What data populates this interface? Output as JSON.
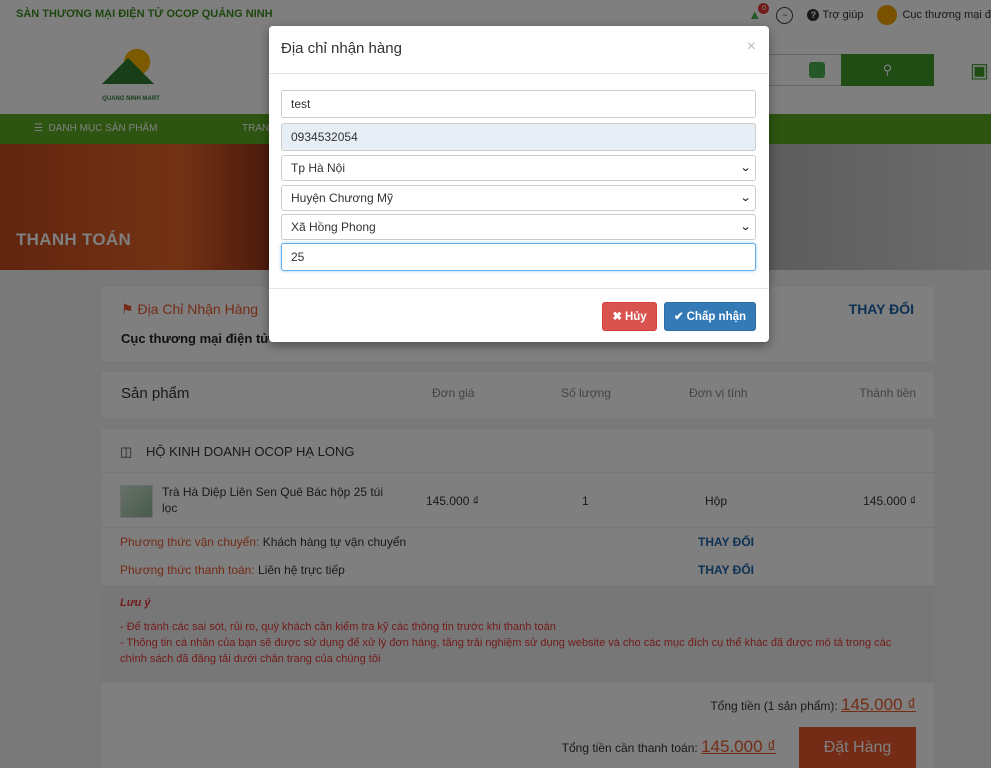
{
  "topbar": {
    "site_name": "SÀN THƯƠNG MẠI ĐIỆN TỬ OCOP QUẢNG NINH",
    "notification_count": "0",
    "help_label": "Trợ giúp",
    "user_label": "Cục thương mại đ"
  },
  "header": {
    "logo_text": "QUANG NINH MART"
  },
  "navbar": {
    "menu_label": "DANH MỤC SẢN PHẨM",
    "item_label": "TRAN"
  },
  "banner": {
    "title": "THANH TOÁN"
  },
  "address": {
    "label": "Địa Chỉ Nhận Hàng",
    "value": "Cục thương mại điện tử",
    "change_label": "THAY ĐỔI"
  },
  "table_header": {
    "product": "Sản phẩm",
    "unit_price": "Đơn giá",
    "quantity": "Số lượng",
    "unit": "Đơn vị tính",
    "total": "Thành tiền"
  },
  "shop": {
    "name": "HỘ KINH DOANH OCOP HẠ LONG",
    "items": [
      {
        "name": "Trà Hà Diệp Liên Sen Quê Bác hộp 25 túi lọc",
        "price": "145.000 ₫",
        "qty": "1",
        "unit": "Hộp",
        "total": "145.000 ₫"
      }
    ],
    "shipping_label": "Phương thức vận chuyển:",
    "shipping_value": "Khách hàng tự vận chuyển",
    "shipping_change": "THAY ĐỔI",
    "payment_label": "Phương thức thanh toán:",
    "payment_value": "Liên hệ trực tiếp",
    "payment_change": "THAY ĐỔI"
  },
  "note": {
    "title": "Lưu ý",
    "line1": "- Để tránh các sai sót, rủi ro, quý khách cần kiểm tra kỹ các thông tin trước khi thanh toán",
    "line2": "- Thông tin cá nhân của bạn sẽ được sử dụng để xử lý đơn hàng, tăng trải nghiệm sử dụng website và cho các mục đích cụ thể khác đã được mô tả trong các chính sách đã đăng tải dưới chân trang của chúng tôi"
  },
  "totals": {
    "subtotal_label": "Tổng tiền (1 sản phẩm):",
    "subtotal_value": "145.000 ₫",
    "pay_label": "Tổng tiền cần thanh toán:",
    "pay_value": "145.000 ₫",
    "order_button": "Đặt Hàng"
  },
  "modal": {
    "title": "Địa chỉ nhận hàng",
    "close": "×",
    "name_value": "test",
    "phone_value": "0934532054",
    "province_value": "Tp Hà Nội",
    "district_value": "Huyện Chương Mỹ",
    "ward_value": "Xã Hồng Phong",
    "street_value": "25",
    "cancel_label": "Hủy",
    "ok_label": "Chấp nhận"
  },
  "icons": {
    "bell": "bell-icon",
    "messenger": "messenger-icon",
    "help": "question-circle-icon",
    "search": "search-icon",
    "cart": "cart-icon",
    "location": "map-marker-icon",
    "basket": "basket-icon",
    "cancel": "times-icon",
    "ok": "check-icon",
    "select_caret": "chevron-down-icon"
  },
  "colors": {
    "brand_green": "#5aa820",
    "accent_orange": "#e8592c",
    "link_blue": "#1c62a9",
    "danger": "#d9534f",
    "primary": "#337ab7"
  }
}
